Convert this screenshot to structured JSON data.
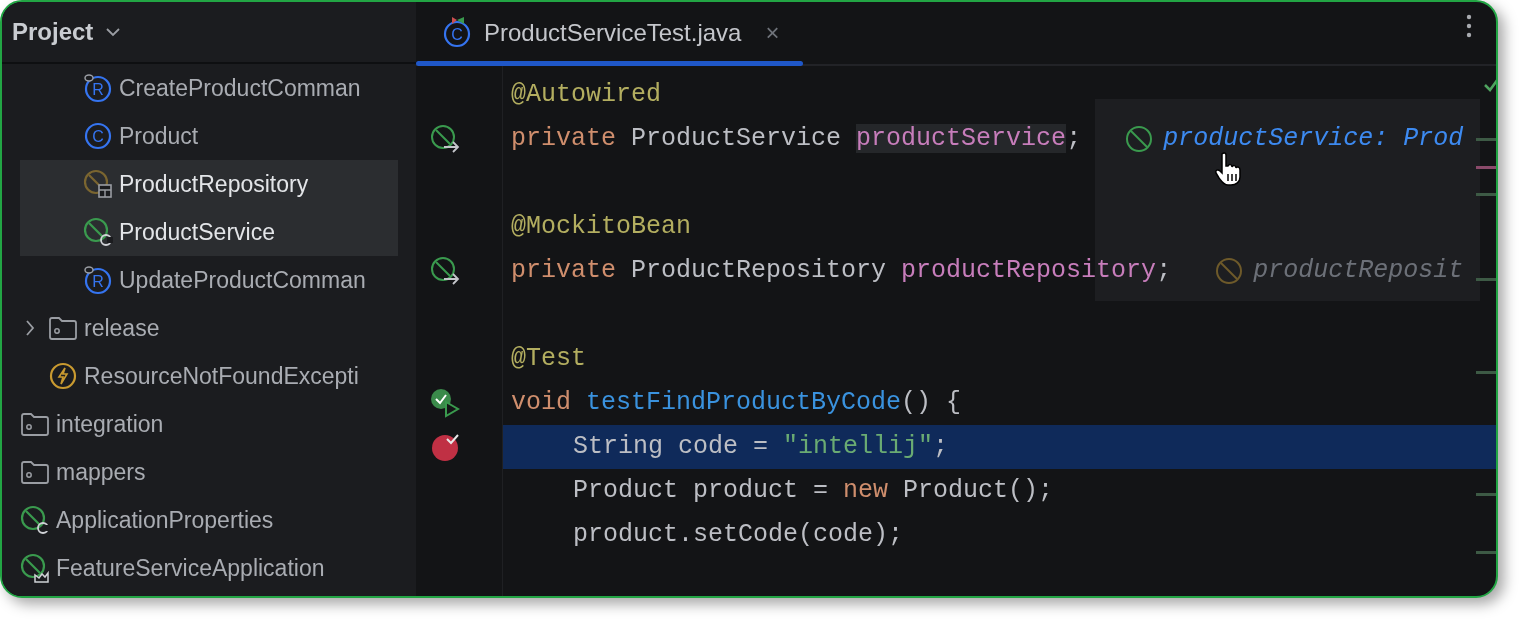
{
  "project_panel": {
    "title": "Project",
    "tree": [
      {
        "children": [
          {
            "children": [
              {
                "label": "CreateProductComman",
                "kind": "record",
                "glyph": "R",
                "selected": false
              },
              {
                "label": "Product",
                "kind": "class",
                "glyph": "C",
                "selected": false
              },
              {
                "label": "ProductRepository",
                "kind": "spring-repository",
                "selected": true
              },
              {
                "label": "ProductService",
                "kind": "spring-component",
                "selected": true
              },
              {
                "label": "UpdateProductComman",
                "kind": "record",
                "glyph": "R",
                "selected": false
              }
            ]
          },
          {
            "label": "release",
            "kind": "folder",
            "selected": false,
            "expanded": false
          },
          {
            "label": "ResourceNotFoundExcepti",
            "kind": "exception",
            "selected": false
          }
        ]
      },
      {
        "label": "integration",
        "kind": "folder",
        "selected": false
      },
      {
        "label": "mappers",
        "kind": "folder",
        "selected": false
      },
      {
        "label": "ApplicationProperties",
        "kind": "spring-component",
        "selected": false
      },
      {
        "label": "FeatureServiceApplication",
        "kind": "spring-app",
        "selected": false
      }
    ]
  },
  "editor": {
    "tabs": [
      {
        "label": "ProductServiceTest.java",
        "glyph": "C",
        "close": "×",
        "selected": true
      }
    ],
    "lines": [
      {
        "kind": "code",
        "highlighted": false,
        "indented": false,
        "tokens": [
          {
            "kind": "annotation",
            "text": "@Autowired"
          }
        ]
      },
      {
        "kind": "code",
        "highlighted": false,
        "indented": false,
        "gutter": {
          "kind": "bean"
        },
        "tokens": [
          {
            "kind": "keyword",
            "text": "private"
          },
          {
            "kind": "plain",
            "text": " ProductService "
          },
          {
            "kind": "occurrence",
            "text": "productService"
          },
          {
            "kind": "plain",
            "text": ";"
          }
        ],
        "hint": {
          "kind": "active",
          "text": "productService: Prod"
        }
      },
      {
        "kind": "blank"
      },
      {
        "kind": "code",
        "highlighted": false,
        "indented": false,
        "tokens": [
          {
            "kind": "annotation",
            "text": "@MockitoBean"
          }
        ]
      },
      {
        "kind": "code",
        "highlighted": false,
        "indented": false,
        "gutter": {
          "kind": "bean"
        },
        "tokens": [
          {
            "kind": "keyword",
            "text": "private"
          },
          {
            "kind": "plain",
            "text": " ProductRepository "
          },
          {
            "kind": "field",
            "text": "productRepository"
          },
          {
            "kind": "plain",
            "text": ";"
          }
        ],
        "hint": {
          "kind": "muted",
          "text": "productReposit"
        }
      },
      {
        "kind": "blank"
      },
      {
        "kind": "code",
        "highlighted": false,
        "indented": false,
        "tokens": [
          {
            "kind": "annotation",
            "text": "@Test"
          }
        ]
      },
      {
        "kind": "code",
        "highlighted": false,
        "indented": false,
        "gutter": {
          "kind": "run-passed"
        },
        "tokens": [
          {
            "kind": "keyword",
            "text": "void "
          },
          {
            "kind": "method",
            "text": "testFindProductByCode"
          },
          {
            "kind": "plain",
            "text": "() {"
          }
        ]
      },
      {
        "kind": "code",
        "highlighted": true,
        "indented": true,
        "gutter": {
          "kind": "breakpoint"
        },
        "tokens": [
          {
            "kind": "plain",
            "text": "String code = "
          },
          {
            "kind": "string",
            "text": "\"intellij\""
          },
          {
            "kind": "plain",
            "text": ";"
          }
        ]
      },
      {
        "kind": "code",
        "highlighted": false,
        "indented": true,
        "tokens": [
          {
            "kind": "plain",
            "text": "Product product = "
          },
          {
            "kind": "keyword",
            "text": "new"
          },
          {
            "kind": "plain",
            "text": " Product();"
          }
        ]
      },
      {
        "kind": "code",
        "highlighted": false,
        "indented": true,
        "tokens": [
          {
            "kind": "plain",
            "text": "product.setCode(code);"
          }
        ]
      }
    ]
  }
}
